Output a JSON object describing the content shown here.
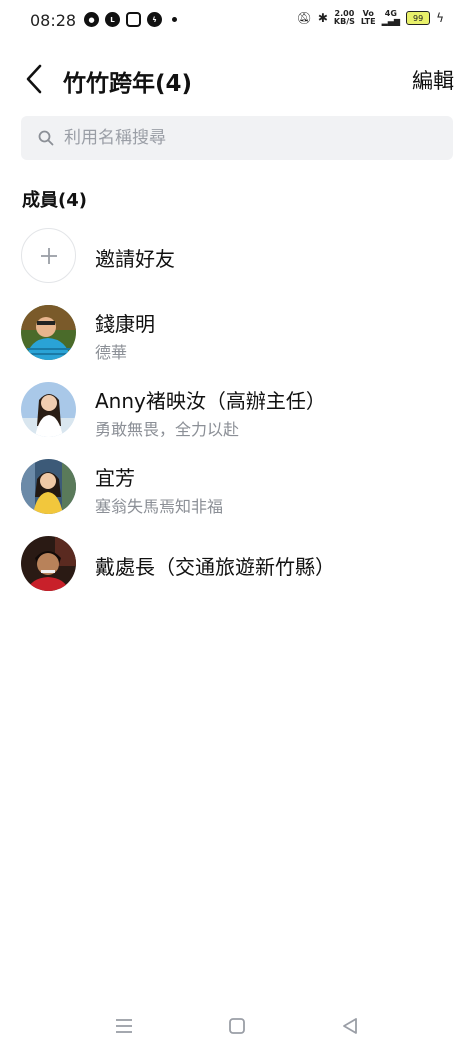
{
  "status_bar": {
    "time": "08:28",
    "network_speed_top": "2.00",
    "network_speed_bottom": "KB/S",
    "volte_top": "Vo",
    "volte_bottom": "LTE",
    "signal_label": "4G",
    "battery": "99",
    "icons": [
      "wechat-icon",
      "line-icon",
      "app-icon",
      "messenger-icon",
      "dot-icon",
      "mute-icon",
      "bluetooth-icon",
      "signal-icon",
      "battery-icon",
      "charging-icon"
    ]
  },
  "header": {
    "title": "竹竹跨年(4)",
    "edit_label": "編輯"
  },
  "search": {
    "placeholder": "利用名稱搜尋"
  },
  "section_label": "成員(4)",
  "invite": {
    "label": "邀請好友"
  },
  "members": [
    {
      "name": "錢康明",
      "status": "德華"
    },
    {
      "name": "Anny褚映汝（高辦主任）",
      "status": "勇敢無畏，全力以赴"
    },
    {
      "name": "宜芳",
      "status": "塞翁失馬焉知非福"
    },
    {
      "name": "戴處長（交通旅遊新竹縣）",
      "status": ""
    }
  ],
  "nav": [
    "menu-icon",
    "home-icon",
    "back-triangle-icon"
  ],
  "colors": {
    "background": "#ffffff",
    "search_bg": "#f1f2f4",
    "secondary_text": "#8b8f96"
  }
}
